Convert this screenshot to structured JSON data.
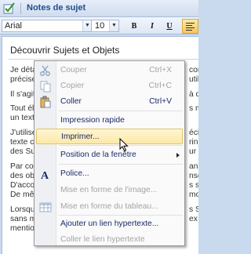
{
  "titlebar": {
    "title": "Notes de sujet"
  },
  "toolbar": {
    "font": "Arial",
    "size": "10",
    "bold": "B",
    "italic": "I",
    "underline": "U"
  },
  "document": {
    "heading": "Découvrir Sujets et Objets",
    "paragraphs": [
      [
        "Je déta",
        "con"
      ],
      [
        "précise",
        "utili"
      ],
      [
        "Il s'agit",
        "à de"
      ],
      [
        "Tout élé",
        "s ma"
      ],
      [
        "un text",
        ""
      ],
      [
        "J'utilise",
        "éci"
      ],
      [
        " texte c",
        "rinc"
      ],
      [
        "des Su",
        "ur e"
      ],
      [
        "Par cor",
        "ans"
      ],
      [
        "des obj",
        "nse"
      ],
      [
        "D'accor",
        "s so"
      ],
      [
        "De mêm",
        "mo"
      ],
      [
        "Lorsque",
        "s S"
      ],
      [
        "sans m",
        "ex"
      ],
      [
        "mention",
        ""
      ]
    ]
  },
  "menu": {
    "items": [
      {
        "label": "Couper",
        "shortcut": "Ctrl+X",
        "icon": "scissors-icon",
        "enabled": false
      },
      {
        "label": "Copier",
        "shortcut": "Ctrl+C",
        "icon": "copy-icon",
        "enabled": false
      },
      {
        "label": "Coller",
        "shortcut": "Ctrl+V",
        "icon": "paste-icon",
        "enabled": true
      },
      {
        "label": "Impression rapide",
        "shortcut": "",
        "icon": "",
        "enabled": true
      },
      {
        "label": "Imprimer...",
        "shortcut": "",
        "icon": "",
        "enabled": true,
        "highlighted": true
      },
      {
        "label": "Position de la fenêtre",
        "shortcut": "",
        "icon": "",
        "enabled": true,
        "submenu": true
      },
      {
        "label": "Police...",
        "shortcut": "",
        "icon": "font-icon",
        "enabled": true
      },
      {
        "label": "Mise en forme de l'image...",
        "shortcut": "",
        "icon": "",
        "enabled": false
      },
      {
        "label": "Mise en forme du tableau...",
        "shortcut": "",
        "icon": "table-icon",
        "enabled": false
      },
      {
        "label": "Ajouter un lien hypertexte...",
        "shortcut": "",
        "icon": "",
        "enabled": true
      },
      {
        "label": "Coller le lien hypertexte",
        "shortcut": "",
        "icon": "",
        "enabled": false
      }
    ]
  },
  "colors": {
    "title_text": "#1f4e8c",
    "highlight_bg": "#fce9a6",
    "menu_text": "#1a2a6a",
    "disabled_text": "#a4a4a4"
  }
}
